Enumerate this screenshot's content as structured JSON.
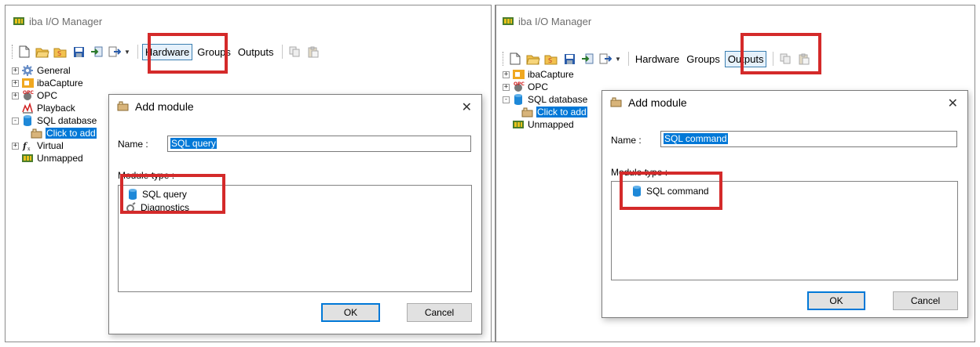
{
  "left": {
    "window": {
      "title": "iba I/O Manager"
    },
    "toolbar": {
      "tabs": [
        "Hardware",
        "Groups",
        "Outputs"
      ],
      "active_tab": "Hardware"
    },
    "tree": {
      "items": [
        {
          "label": "General",
          "icon": "gear-icon",
          "expander": "+"
        },
        {
          "label": "ibaCapture",
          "icon": "capture-icon",
          "expander": "+"
        },
        {
          "label": "OPC",
          "icon": "opc-icon",
          "expander": "+"
        },
        {
          "label": "Playback",
          "icon": "playback-icon",
          "expander": ""
        },
        {
          "label": "SQL database",
          "icon": "database-icon",
          "expander": "-"
        },
        {
          "label": "Click to add",
          "icon": "add-module-icon",
          "expander": "",
          "selected": true
        },
        {
          "label": "Virtual",
          "icon": "function-icon",
          "expander": "+"
        },
        {
          "label": "Unmapped",
          "icon": "unmapped-icon",
          "expander": ""
        }
      ]
    },
    "dialog": {
      "title": "Add module",
      "name_label": "Name :",
      "name_value": "SQL query",
      "module_type_label": "Module type :",
      "module_types": [
        {
          "label": "SQL query",
          "icon": "database-icon"
        },
        {
          "label": "Diagnostics",
          "icon": "diagnostics-icon"
        }
      ],
      "ok_label": "OK",
      "cancel_label": "Cancel"
    }
  },
  "right": {
    "window": {
      "title": "iba I/O Manager"
    },
    "toolbar": {
      "tabs": [
        "Hardware",
        "Groups",
        "Outputs"
      ],
      "active_tab": "Outputs"
    },
    "tree": {
      "items": [
        {
          "label": "ibaCapture",
          "icon": "capture-icon",
          "expander": "+"
        },
        {
          "label": "OPC",
          "icon": "opc-icon",
          "expander": "+"
        },
        {
          "label": "SQL database",
          "icon": "database-icon",
          "expander": "-"
        },
        {
          "label": "Click to add",
          "icon": "add-module-icon",
          "expander": "",
          "selected": true
        },
        {
          "label": "Unmapped",
          "icon": "unmapped-icon",
          "expander": ""
        }
      ]
    },
    "dialog": {
      "title": "Add module",
      "name_label": "Name :",
      "name_value": "SQL command",
      "module_type_label": "Module type :",
      "module_types": [
        {
          "label": "SQL command",
          "icon": "database-icon"
        }
      ],
      "ok_label": "OK",
      "cancel_label": "Cancel"
    }
  },
  "colors": {
    "highlight": "#d42a2a",
    "selection": "#0078d7",
    "database": "#1e88d8"
  }
}
